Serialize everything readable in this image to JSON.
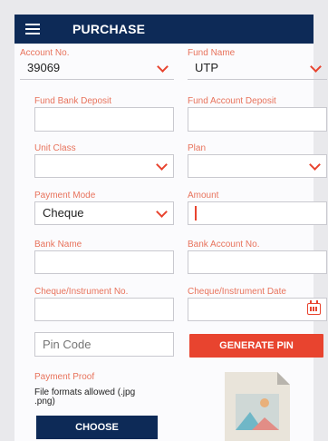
{
  "header": {
    "title": "PURCHASE"
  },
  "form": {
    "account_no": {
      "label": "Account No.",
      "value": "39069"
    },
    "fund_name": {
      "label": "Fund Name",
      "value": "UTP"
    },
    "fund_bank_deposit": {
      "label": "Fund Bank Deposit",
      "value": ""
    },
    "fund_account_deposit": {
      "label": "Fund Account Deposit",
      "value": ""
    },
    "unit_class": {
      "label": "Unit Class",
      "value": ""
    },
    "plan": {
      "label": "Plan",
      "value": ""
    },
    "payment_mode": {
      "label": "Payment Mode",
      "value": "Cheque"
    },
    "amount": {
      "label": "Amount",
      "value": ""
    },
    "bank_name": {
      "label": "Bank Name",
      "value": ""
    },
    "bank_account_no": {
      "label": "Bank Account No.",
      "value": ""
    },
    "cheque_no": {
      "label": "Cheque/Instrument No.",
      "value": ""
    },
    "cheque_date": {
      "label": "Cheque/Instrument Date",
      "value": ""
    },
    "pin_code": {
      "placeholder": "Pin Code"
    },
    "generate_pin": "GENERATE PIN",
    "payment_proof": {
      "label": "Payment Proof",
      "note": "File formats allowed (.jpg .png)",
      "choose": "CHOOSE"
    }
  },
  "colors": {
    "primary": "#0d2a57",
    "accent": "#e8442f",
    "label": "#e8735c"
  },
  "icons": [
    "menu-icon",
    "chevron-down-icon",
    "calendar-icon",
    "image-file-icon"
  ]
}
